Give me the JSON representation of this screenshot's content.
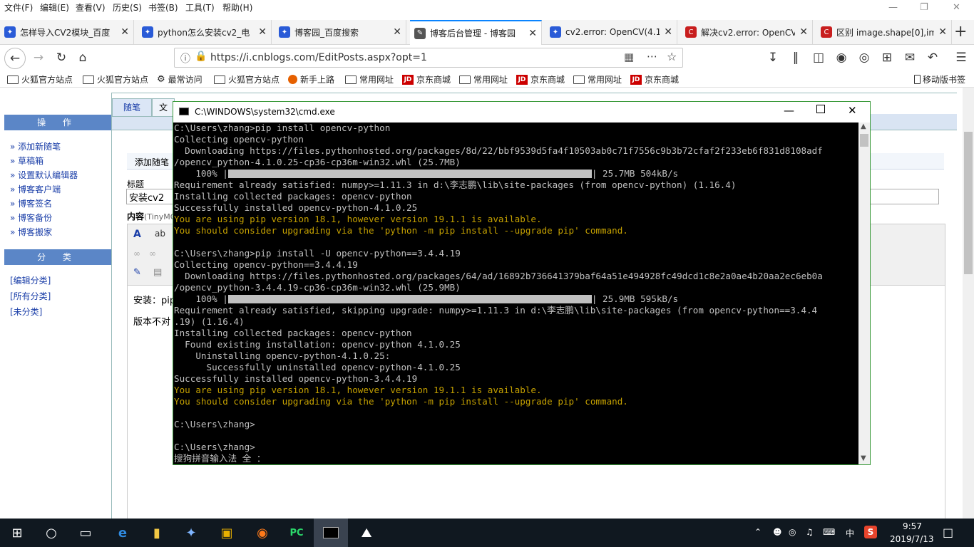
{
  "menubar": {
    "items": [
      "文件(F)",
      "编辑(E)",
      "查看(V)",
      "历史(S)",
      "书签(B)",
      "工具(T)",
      "帮助(H)"
    ]
  },
  "tabs": [
    {
      "title": "怎样导入CV2模块_百度",
      "icon": "baidu-paw-icon",
      "color": "#2a5bd7"
    },
    {
      "title": "python怎么安装cv2_电",
      "icon": "baidu-paw-icon",
      "color": "#2a5bd7"
    },
    {
      "title": "博客园_百度搜索",
      "icon": "baidu-paw-icon",
      "color": "#2a5bd7"
    },
    {
      "title": "博客后台管理 - 博客园",
      "icon": "cnblogs-icon",
      "color": "#555555",
      "active": true
    },
    {
      "title": "cv2.error: OpenCV(4.1",
      "icon": "baidu-paw-icon",
      "color": "#2a5bd7"
    },
    {
      "title": "解决cv2.error: OpenCV",
      "icon": "csdn-icon",
      "color": "#c81e1e"
    },
    {
      "title": "区别 image.shape[0],im",
      "icon": "csdn-icon",
      "color": "#c81e1e"
    }
  ],
  "address": {
    "url": "https://i.cnblogs.com/EditPosts.aspx?opt=1"
  },
  "bookmarks": [
    {
      "label": "火狐官方站点",
      "icon": "folder-icon"
    },
    {
      "label": "火狐官方站点",
      "icon": "folder-icon"
    },
    {
      "label": "最常访问",
      "icon": "gear-icon"
    },
    {
      "label": "火狐官方站点",
      "icon": "folder-icon"
    },
    {
      "label": "新手上路",
      "icon": "firefox-icon"
    },
    {
      "label": "常用网址",
      "icon": "folder-icon"
    },
    {
      "label": "京东商城",
      "icon": "jd-icon"
    },
    {
      "label": "常用网址",
      "icon": "folder-icon"
    },
    {
      "label": "京东商城",
      "icon": "jd-icon"
    },
    {
      "label": "常用网址",
      "icon": "folder-icon"
    },
    {
      "label": "京东商城",
      "icon": "jd-icon"
    }
  ],
  "mobile_bookmarks": "移动版书签",
  "sidebar": {
    "ops_title": "操 作",
    "ops": [
      "添加新随笔",
      "草稿箱",
      "设置默认编辑器",
      "博客客户端",
      "博客签名",
      "博客备份",
      "博客搬家"
    ],
    "cat_title": "分 类",
    "cats": [
      "[编辑分类]",
      "[所有分类]",
      "[未分类]"
    ]
  },
  "editor": {
    "tab_active": "随笔",
    "tab_next": "文",
    "section": "添加随笔",
    "title_label": "标题",
    "title_value": "安装cv2",
    "content_label": "内容",
    "content_hint": "(TinyMC",
    "body_line1": "安装：pip",
    "body_line2": "版本不对"
  },
  "cmd": {
    "title": "C:\\WINDOWS\\system32\\cmd.exe",
    "lines": [
      {
        "t": "C:\\Users\\zhang>pip install opencv-python"
      },
      {
        "t": "Collecting opencv-python"
      },
      {
        "t": "  Downloading https://files.pythonhosted.org/packages/8d/22/bbf9539d5fa4f10503ab0c71f7556c9b3b72cfaf2f233eb6f831d8108adf"
      },
      {
        "t": "/opencv_python-4.1.0.25-cp36-cp36m-win32.whl (25.7MB)"
      },
      {
        "t": "    100% |",
        "bar": true,
        "tail": "| 25.7MB 504kB/s"
      },
      {
        "t": "Requirement already satisfied: numpy>=1.11.3 in d:\\李志鹏\\lib\\site-packages (from opencv-python) (1.16.4)"
      },
      {
        "t": "Installing collected packages: opencv-python"
      },
      {
        "t": "Successfully installed opencv-python-4.1.0.25"
      },
      {
        "t": "You are using pip version 18.1, however version 19.1.1 is available.",
        "y": true
      },
      {
        "t": "You should consider upgrading via the 'python -m pip install --upgrade pip' command.",
        "y": true
      },
      {
        "t": ""
      },
      {
        "t": "C:\\Users\\zhang>pip install -U opencv-python==3.4.4.19"
      },
      {
        "t": "Collecting opencv-python==3.4.4.19"
      },
      {
        "t": "  Downloading https://files.pythonhosted.org/packages/64/ad/16892b736641379baf64a51e494928fc49dcd1c8e2a0ae4b20aa2ec6eb0a"
      },
      {
        "t": "/opencv_python-3.4.4.19-cp36-cp36m-win32.whl (25.9MB)"
      },
      {
        "t": "    100% |",
        "bar": true,
        "tail": "| 25.9MB 595kB/s"
      },
      {
        "t": "Requirement already satisfied, skipping upgrade: numpy>=1.11.3 in d:\\李志鹏\\lib\\site-packages (from opencv-python==3.4.4"
      },
      {
        "t": ".19) (1.16.4)"
      },
      {
        "t": "Installing collected packages: opencv-python"
      },
      {
        "t": "  Found existing installation: opencv-python 4.1.0.25"
      },
      {
        "t": "    Uninstalling opencv-python-4.1.0.25:"
      },
      {
        "t": "      Successfully uninstalled opencv-python-4.1.0.25"
      },
      {
        "t": "Successfully installed opencv-python-3.4.4.19"
      },
      {
        "t": "You are using pip version 18.1, however version 19.1.1 is available.",
        "y": true
      },
      {
        "t": "You should consider upgrading via the 'python -m pip install --upgrade pip' command.",
        "y": true
      },
      {
        "t": ""
      },
      {
        "t": "C:\\Users\\zhang>"
      },
      {
        "t": ""
      },
      {
        "t": "C:\\Users\\zhang>"
      },
      {
        "t": "搜狗拼音输入法 全 ："
      }
    ]
  },
  "taskbar": {
    "time": "9:57",
    "date": "2019/7/13",
    "ime": "中"
  }
}
